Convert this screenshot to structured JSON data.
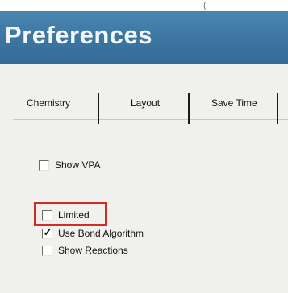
{
  "window": {
    "clipped_text": "(",
    "title": "Preferences"
  },
  "tabs": [
    {
      "label": "Chemistry",
      "selected": true
    },
    {
      "label": "Layout",
      "selected": false
    },
    {
      "label": "Save Time",
      "selected": false
    }
  ],
  "options": [
    {
      "label": "Show VPA",
      "checked": false
    },
    {
      "label": "Limited",
      "checked": false,
      "highlighted": true
    },
    {
      "label": "Use Bond Algorithm",
      "checked": true
    },
    {
      "label": "Show Reactions",
      "checked": false
    }
  ],
  "colors": {
    "title_bar": "#3b75a0",
    "panel": "#f0f0ec",
    "highlight": "#d42a2a"
  }
}
